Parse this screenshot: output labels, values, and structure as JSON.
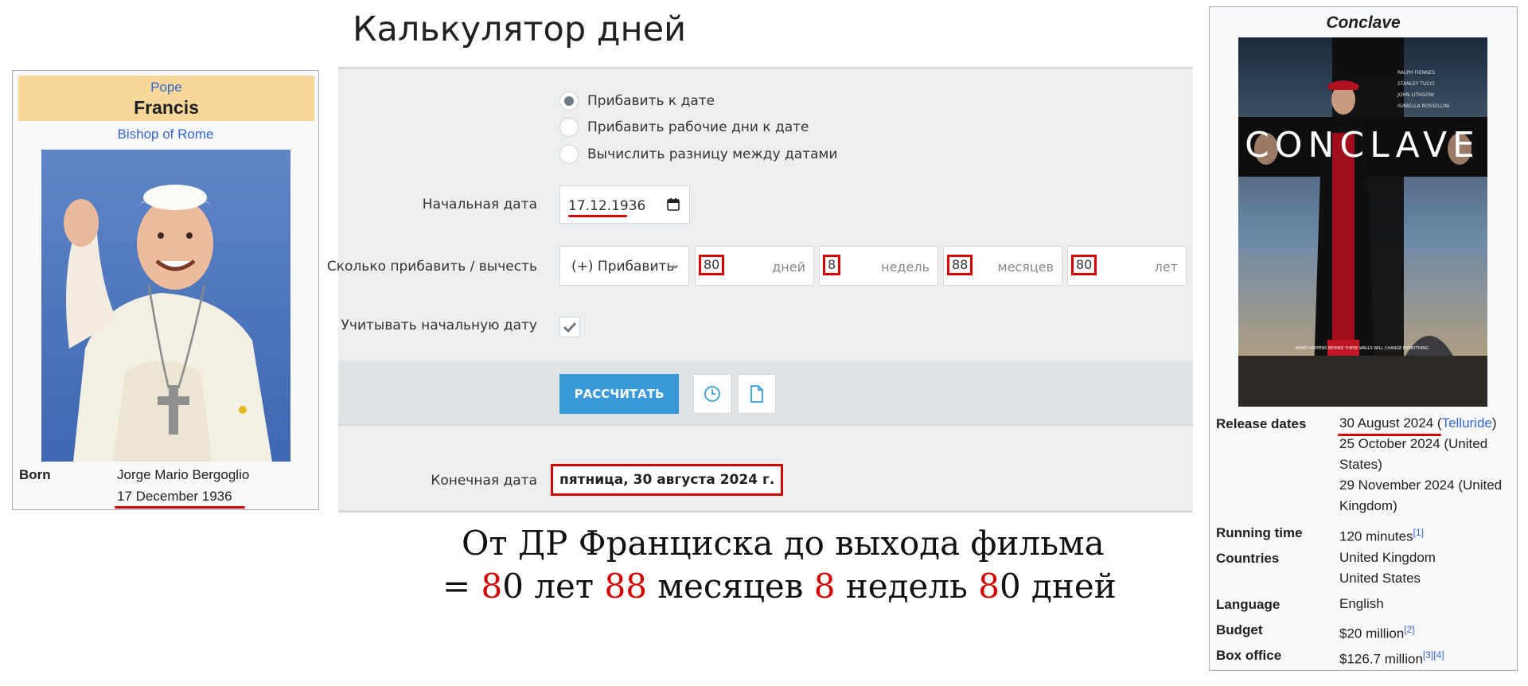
{
  "pope_infobox": {
    "office": "Pope",
    "name": "Francis",
    "see": "Bishop of Rome",
    "born_label": "Born",
    "born_name": "Jorge Mario Bergoglio",
    "born_date": "17 December 1936"
  },
  "calculator": {
    "title": "Калькулятор дней",
    "modes": [
      {
        "label": "Прибавить к дате",
        "selected": true
      },
      {
        "label": "Прибавить рабочие дни к дате",
        "selected": false
      },
      {
        "label": "Вычислить разницу между датами",
        "selected": false
      }
    ],
    "start_date_label": "Начальная дата",
    "start_date_value": "17.12.1936",
    "amount_label": "Сколько прибавить / вычесть",
    "operation_value": "(+) Прибавить",
    "fields": [
      {
        "value": "80",
        "unit": "дней"
      },
      {
        "value": "8",
        "unit": "недель"
      },
      {
        "value": "88",
        "unit": "месяцев"
      },
      {
        "value": "80",
        "unit": "лет"
      }
    ],
    "include_start_label": "Учитывать начальную дату",
    "include_start_checked": true,
    "calculate_button": "РАССЧИТАТЬ",
    "end_date_label": "Конечная дата",
    "end_date_value": "пятница, 30 августа 2024 г."
  },
  "caption": {
    "line1": "От ДР Франциска до выхода фильма",
    "line2_parts": [
      "= ",
      "8",
      "0 лет ",
      "88",
      " месяцев ",
      "8",
      " недель ",
      "8",
      "0 дней"
    ]
  },
  "film_infobox": {
    "title": "Conclave",
    "poster_text": {
      "title": "CONCLAVE",
      "tagline": "WHAT HAPPENS BEHIND THESE WALLS WILL CHANGE EVERYTHING.",
      "cast": [
        "RALPH FIENNES",
        "STANLEY TUCCI",
        "JOHN LITHGOW",
        "ISABELLA ROSSELLINI"
      ]
    },
    "release_label": "Release dates",
    "release_1_date": "30 August 2024",
    "release_1_place": "Telluride",
    "release_2": "25 October 2024 (United States)",
    "release_3": "29 November 2024 (United Kingdom)",
    "running_label": "Running time",
    "running_value": "120 minutes",
    "running_ref": "[1]",
    "countries_label": "Countries",
    "countries": [
      "United Kingdom",
      "United States"
    ],
    "language_label": "Language",
    "language_value": "English",
    "budget_label": "Budget",
    "budget_value": "$20 million",
    "budget_ref": "[2]",
    "boxoffice_label": "Box office",
    "boxoffice_value": "$126.7 million",
    "boxoffice_refs": "[3][4]"
  },
  "colors": {
    "highlight_red": "#d40000",
    "button_blue": "#3a9ad9",
    "link_blue": "#3366cc",
    "pope_header": "#f6d89a"
  }
}
